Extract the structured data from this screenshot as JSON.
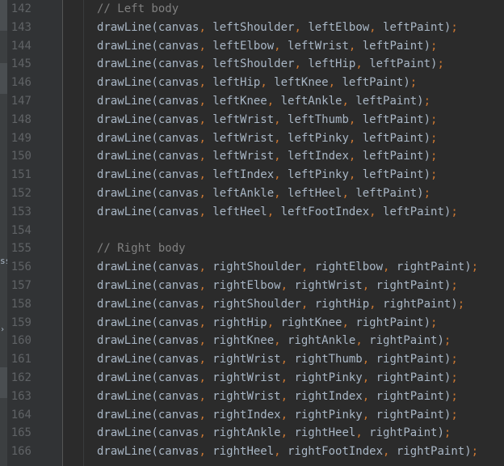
{
  "editor": {
    "line_numbers": [
      "142",
      "143",
      "144",
      "145",
      "146",
      "147",
      "148",
      "149",
      "150",
      "151",
      "152",
      "153",
      "154",
      "155",
      "156",
      "157",
      "158",
      "159",
      "160",
      "161",
      "162",
      "163",
      "164",
      "165",
      "166"
    ],
    "lines": [
      {
        "type": "comment",
        "text": "// Left body"
      },
      {
        "type": "call",
        "name": "drawLine(canvas",
        "args": [
          "leftShoulder",
          "leftElbow",
          "leftPaint"
        ]
      },
      {
        "type": "call",
        "name": "drawLine(canvas",
        "args": [
          "leftElbow",
          "leftWrist",
          "leftPaint"
        ]
      },
      {
        "type": "call",
        "name": "drawLine(canvas",
        "args": [
          "leftShoulder",
          "leftHip",
          "leftPaint"
        ]
      },
      {
        "type": "call",
        "name": "drawLine(canvas",
        "args": [
          "leftHip",
          "leftKnee",
          "leftPaint"
        ]
      },
      {
        "type": "call",
        "name": "drawLine(canvas",
        "args": [
          "leftKnee",
          "leftAnkle",
          "leftPaint"
        ]
      },
      {
        "type": "call",
        "name": "drawLine(canvas",
        "args": [
          "leftWrist",
          "leftThumb",
          "leftPaint"
        ]
      },
      {
        "type": "call",
        "name": "drawLine(canvas",
        "args": [
          "leftWrist",
          "leftPinky",
          "leftPaint"
        ]
      },
      {
        "type": "call",
        "name": "drawLine(canvas",
        "args": [
          "leftWrist",
          "leftIndex",
          "leftPaint"
        ]
      },
      {
        "type": "call",
        "name": "drawLine(canvas",
        "args": [
          "leftIndex",
          "leftPinky",
          "leftPaint"
        ]
      },
      {
        "type": "call",
        "name": "drawLine(canvas",
        "args": [
          "leftAnkle",
          "leftHeel",
          "leftPaint"
        ]
      },
      {
        "type": "call",
        "name": "drawLine(canvas",
        "args": [
          "leftHeel",
          "leftFootIndex",
          "leftPaint"
        ]
      },
      {
        "type": "blank",
        "text": ""
      },
      {
        "type": "comment",
        "text": "// Right body"
      },
      {
        "type": "call",
        "name": "drawLine(canvas",
        "args": [
          "rightShoulder",
          "rightElbow",
          "rightPaint"
        ]
      },
      {
        "type": "call",
        "name": "drawLine(canvas",
        "args": [
          "rightElbow",
          "rightWrist",
          "rightPaint"
        ]
      },
      {
        "type": "call",
        "name": "drawLine(canvas",
        "args": [
          "rightShoulder",
          "rightHip",
          "rightPaint"
        ]
      },
      {
        "type": "call",
        "name": "drawLine(canvas",
        "args": [
          "rightHip",
          "rightKnee",
          "rightPaint"
        ]
      },
      {
        "type": "call",
        "name": "drawLine(canvas",
        "args": [
          "rightKnee",
          "rightAnkle",
          "rightPaint"
        ]
      },
      {
        "type": "call",
        "name": "drawLine(canvas",
        "args": [
          "rightWrist",
          "rightThumb",
          "rightPaint"
        ]
      },
      {
        "type": "call",
        "name": "drawLine(canvas",
        "args": [
          "rightWrist",
          "rightPinky",
          "rightPaint"
        ]
      },
      {
        "type": "call",
        "name": "drawLine(canvas",
        "args": [
          "rightWrist",
          "rightIndex",
          "rightPaint"
        ]
      },
      {
        "type": "call",
        "name": "drawLine(canvas",
        "args": [
          "rightIndex",
          "rightPinky",
          "rightPaint"
        ]
      },
      {
        "type": "call",
        "name": "drawLine(canvas",
        "args": [
          "rightAnkle",
          "rightHeel",
          "rightPaint"
        ]
      },
      {
        "type": "call",
        "name": "drawLine(canvas",
        "args": [
          "rightHeel",
          "rightFootIndex",
          "rightPaint"
        ]
      }
    ],
    "side_panel_fragment": "ss",
    "side_panel_arrow": "›"
  },
  "colors": {
    "background": "#2b2b2b",
    "gutter": "#313335",
    "line_number": "#606366",
    "text": "#a9b7c6",
    "punctuation": "#cc7832",
    "comment": "#808080"
  }
}
